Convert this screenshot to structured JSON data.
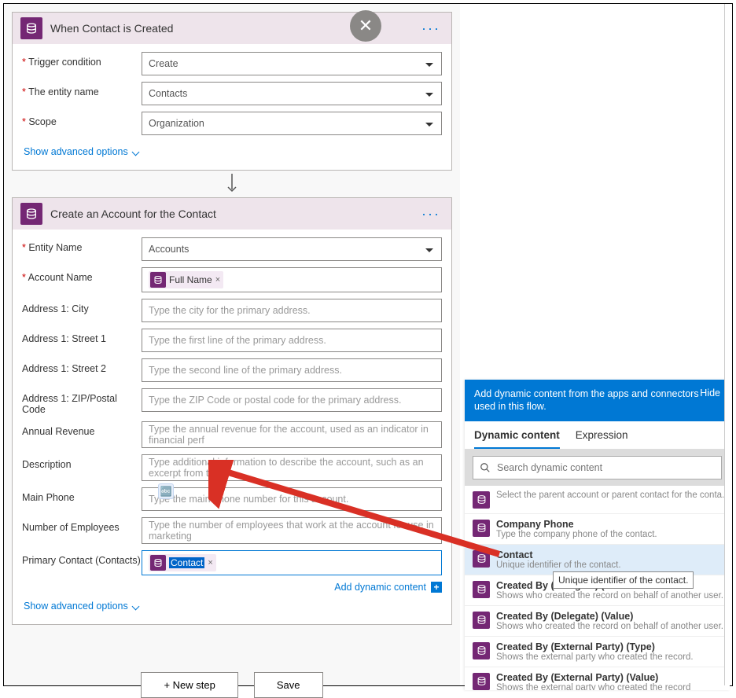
{
  "trigger": {
    "title": "When Contact is Created",
    "fields": {
      "condition": {
        "label": "Trigger condition",
        "value": "Create"
      },
      "entity": {
        "label": "The entity name",
        "value": "Contacts"
      },
      "scope": {
        "label": "Scope",
        "value": "Organization"
      }
    },
    "advanced": "Show advanced options"
  },
  "action": {
    "title": "Create an Account for the Contact",
    "fields": {
      "entityName": {
        "label": "Entity Name",
        "value": "Accounts"
      },
      "accountName": {
        "label": "Account Name",
        "token": "Full Name"
      },
      "city": {
        "label": "Address 1: City",
        "placeholder": "Type the city for the primary address."
      },
      "street1": {
        "label": "Address 1: Street 1",
        "placeholder": "Type the first line of the primary address."
      },
      "street2": {
        "label": "Address 1: Street 2",
        "placeholder": "Type the second line of the primary address."
      },
      "zip": {
        "label": "Address 1: ZIP/Postal Code",
        "placeholder": "Type the ZIP Code or postal code for the primary address."
      },
      "revenue": {
        "label": "Annual Revenue",
        "placeholder": "Type the annual revenue for the account, used as an indicator in financial perf"
      },
      "description": {
        "label": "Description",
        "placeholder": "Type additional information to describe the account, such as an excerpt from t"
      },
      "mainPhone": {
        "label": "Main Phone",
        "placeholder": "Type the main phone number for this account."
      },
      "employees": {
        "label": "Number of Employees",
        "placeholder": "Type the number of employees that work at the account for use in marketing"
      },
      "primaryContact": {
        "label": "Primary Contact (Contacts)",
        "token": "Contact"
      }
    },
    "addDynamic": "Add dynamic content",
    "advanced": "Show advanced options"
  },
  "buttons": {
    "newStep": "+ New step",
    "save": "Save"
  },
  "dyn": {
    "header": "Add dynamic content from the apps and connectors used in this flow.",
    "hide": "Hide",
    "tabs": {
      "content": "Dynamic content",
      "expression": "Expression"
    },
    "searchPlaceholder": "Search dynamic content",
    "items": [
      {
        "title": "",
        "desc": "Select the parent account or parent contact for the conta..."
      },
      {
        "title": "Company Phone",
        "desc": "Type the company phone of the contact."
      },
      {
        "title": "Contact",
        "desc": "Unique identifier of the contact.",
        "highlight": true
      },
      {
        "title": "Created By (Delegate) (",
        "desc": "Shows who created the record on behalf of another user."
      },
      {
        "title": "Created By (Delegate) (Value)",
        "desc": "Shows who created the record on behalf of another user."
      },
      {
        "title": "Created By (External Party) (Type)",
        "desc": "Shows the external party who created the record."
      },
      {
        "title": "Created By (External Party) (Value)",
        "desc": "Shows the external party who created the record"
      }
    ],
    "tooltip": "Unique identifier of the contact."
  }
}
